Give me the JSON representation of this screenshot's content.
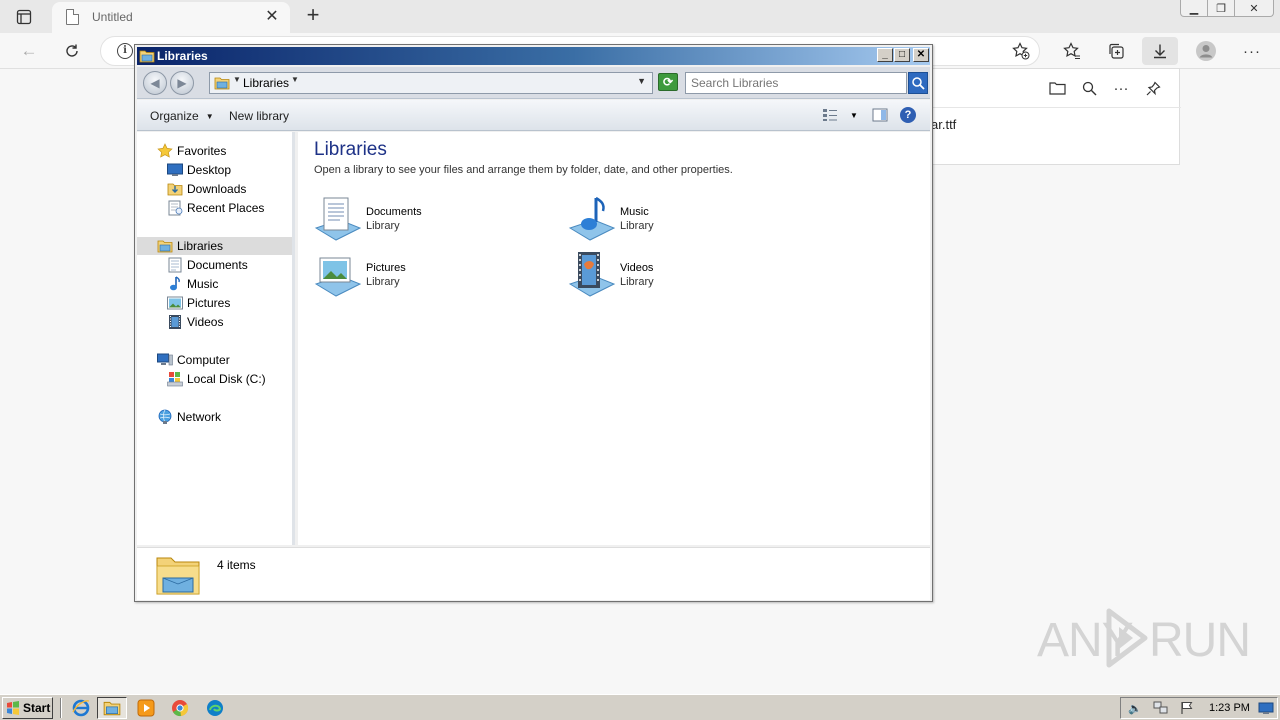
{
  "browser": {
    "tab_title": "Untitled",
    "tab_close": "✕",
    "new_tab": "+",
    "download_file_partial": "ar.ttf",
    "watermark_left": "ANY",
    "watermark_right": "RUN"
  },
  "explorer": {
    "window_title": "Libraries",
    "breadcrumb": "Libraries",
    "search_placeholder": "Search Libraries",
    "commands": {
      "organize": "Organize",
      "new_library": "New library"
    },
    "nav": {
      "favorites": "Favorites",
      "desktop": "Desktop",
      "downloads": "Downloads",
      "recent_places": "Recent Places",
      "libraries": "Libraries",
      "documents": "Documents",
      "music": "Music",
      "pictures": "Pictures",
      "videos": "Videos",
      "computer": "Computer",
      "local_disk": "Local Disk (C:)",
      "network": "Network"
    },
    "content": {
      "title": "Libraries",
      "description": "Open a library to see your files and arrange them by folder, date, and other properties.",
      "libraries": [
        {
          "name": "Documents",
          "type": "Library",
          "icon": "documents-library-icon"
        },
        {
          "name": "Music",
          "type": "Library",
          "icon": "music-library-icon"
        },
        {
          "name": "Pictures",
          "type": "Library",
          "icon": "pictures-library-icon"
        },
        {
          "name": "Videos",
          "type": "Library",
          "icon": "videos-library-icon"
        }
      ]
    },
    "status": "4 items"
  },
  "taskbar": {
    "start_label": "Start",
    "clock": "1:23 PM"
  },
  "colors": {
    "titlebar_start": "#0a246a",
    "titlebar_end": "#a6caf0",
    "content_title": "#1e3287",
    "taskbar": "#d4d0c8"
  }
}
